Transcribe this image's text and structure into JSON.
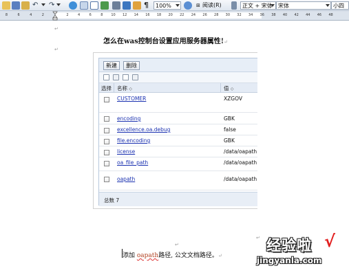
{
  "toolbar": {
    "icons": [
      "open-icon",
      "save-icon",
      "spellcheck-icon",
      "undo-icon",
      "redo-icon",
      "hyperlink-icon",
      "tables-borders-icon",
      "insert-table-icon",
      "insert-excel-icon",
      "columns-icon",
      "drawing-icon",
      "document-map-icon",
      "show-hide-icon"
    ],
    "zoom": "100%",
    "read_mode_label": "阅读(R)",
    "style_value": "正文 + 宋体",
    "font_value": "宋体",
    "size_value": "小四"
  },
  "ruler": {
    "left_labels": [
      "8",
      "6",
      "4",
      "2"
    ],
    "right_labels": [
      "2",
      "4",
      "6",
      "8",
      "10",
      "12",
      "14",
      "16",
      "18",
      "20",
      "22",
      "24",
      "26",
      "28",
      "30",
      "32",
      "34",
      "36",
      "38",
      "40",
      "42",
      "44",
      "46",
      "48"
    ]
  },
  "document": {
    "title": "怎么在was控制台设置应用服务器属性!",
    "paragraph_mark": "↵",
    "caption_prefix": "添加 ",
    "caption_word": "oapath",
    "caption_suffix": "路径, 公文文档路径。"
  },
  "embedded": {
    "new_button": "新建",
    "delete_button": "删除",
    "headers": {
      "select": "选择",
      "name": "名称",
      "value": "值",
      "sorter": "◇"
    },
    "rows": [
      {
        "name": "CUSTOMER",
        "value": "XZGOV"
      },
      {
        "name": "encoding",
        "value": "GBK"
      },
      {
        "name": "excellence.oa.debug",
        "value": "false"
      },
      {
        "name": "file.encoding",
        "value": "GBK"
      },
      {
        "name": "license",
        "value": "/data/oapath"
      },
      {
        "name": "oa_file_path",
        "value": "/data/oapath"
      },
      {
        "name": "oapath",
        "value": "/data/oapath"
      }
    ],
    "total": "总数 7"
  },
  "watermark": {
    "brand": "经验啦",
    "check": "√",
    "url": "jingyanla.com"
  }
}
